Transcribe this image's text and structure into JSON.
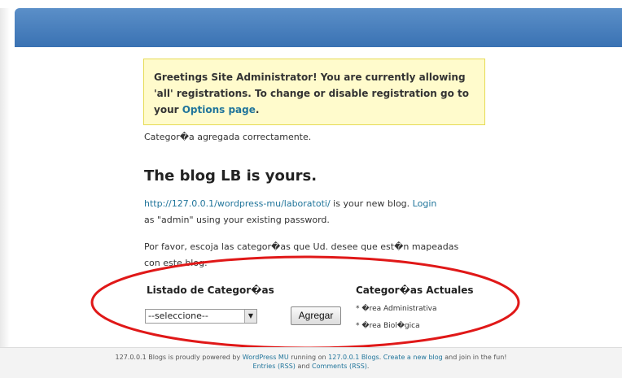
{
  "notice": {
    "text_before": "Greetings Site Administrator! You are currently allowing 'all' registrations. To change or disable registration go to your ",
    "link": "Options page",
    "text_after": "."
  },
  "message": "Categor�a agregada correctamente.",
  "blog_title": "The blog LB is yours.",
  "blog_info": {
    "url": "http://127.0.0.1/wordpress-mu/laboratoti/",
    "text_mid": " is your new blog. ",
    "login": "Login",
    "text_after": " as \"admin\" using your existing password."
  },
  "category_prompt": "Por favor, escoja las categor�as que Ud. desee que est�n mapeadas con este blog.",
  "category_list": {
    "label": "Listado de Categor�as",
    "select_value": "--seleccione--",
    "button": "Agregar"
  },
  "current_categories": {
    "label": "Categor�as Actuales",
    "items": [
      "�rea Administrativa",
      "�rea Biol�gica"
    ]
  },
  "footer": {
    "t1": "127.0.0.1 Blogs is proudly powered by ",
    "l1": "WordPress MU",
    "t2": " running on ",
    "l2": "127.0.0.1 Blogs",
    "t3": ". ",
    "l3": "Create a new blog",
    "t4": " and join in the fun!",
    "l4": "Entries (RSS)",
    "t5": " and ",
    "l5": "Comments (RSS)",
    "t6": "."
  },
  "colors": {
    "header": "#3a72b3",
    "link": "#21759b",
    "notice_bg": "#fffbcc",
    "annotation": "#e01818"
  },
  "icons": {
    "select_arrow": "chevron-down-icon"
  }
}
